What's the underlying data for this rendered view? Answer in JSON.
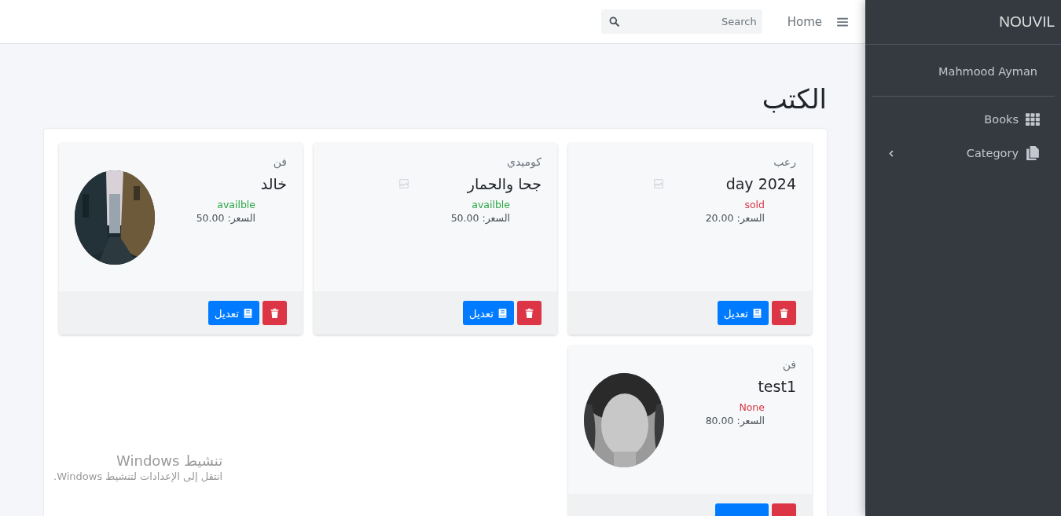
{
  "sidebar": {
    "brand": "NOUVIL",
    "user": "Mahmood Ayman",
    "items": [
      {
        "label": "Books",
        "has_children": false
      },
      {
        "label": "Category",
        "has_children": true
      }
    ]
  },
  "navbar": {
    "home": "Home",
    "search": {
      "placeholder": "Search"
    }
  },
  "page_title": "الكتب",
  "books": [
    {
      "category": "رعب",
      "title": "day 2024",
      "status": {
        "text": "sold",
        "color": "#dc3545"
      },
      "price": "السعر: 20.00",
      "kind": "broken",
      "edit": "تعديل"
    },
    {
      "category": "كوميدي",
      "title": "جحا والحمار",
      "status": {
        "text": "availble",
        "color": "#28a745"
      },
      "price": "السعر: 50.00",
      "kind": "broken",
      "edit": "تعديل"
    },
    {
      "category": "فن",
      "title": "خالد",
      "status": {
        "text": "availble",
        "color": "#28a745"
      },
      "price": "السعر: 50.00",
      "kind": "picture",
      "edit": "تعديل"
    },
    {
      "category": "فن",
      "title": "test1",
      "status": {
        "text": "None",
        "color": "#dc3545"
      },
      "price": "السعر: 80.00",
      "kind": "picture"
    }
  ],
  "os_overlay": {
    "title": "تنشيط Windows",
    "subtitle": "انتقل إلى الإعدادات لتنشيط Windows."
  }
}
